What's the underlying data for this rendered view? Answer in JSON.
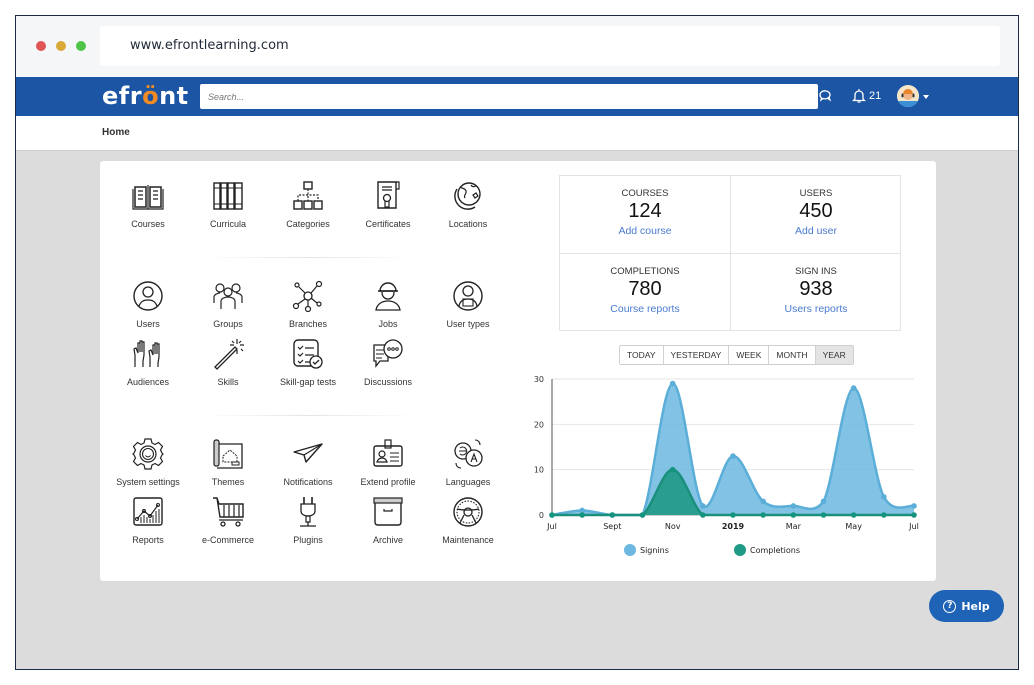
{
  "browser": {
    "url": "www.efrontlearning.com"
  },
  "navbar": {
    "logo": "efront",
    "search_placeholder": "Search...",
    "notifications_count": "21"
  },
  "breadcrumb": "Home",
  "tiles": {
    "admin": [
      {
        "label": "Courses",
        "icon": "book-icon"
      },
      {
        "label": "Curricula",
        "icon": "bookshelf-icon"
      },
      {
        "label": "Categories",
        "icon": "hierarchy-icon"
      },
      {
        "label": "Certificates",
        "icon": "certificate-icon"
      },
      {
        "label": "Locations",
        "icon": "globe-icon"
      }
    ],
    "people": [
      {
        "label": "Users",
        "icon": "user-icon"
      },
      {
        "label": "Groups",
        "icon": "group-icon"
      },
      {
        "label": "Branches",
        "icon": "branches-icon"
      },
      {
        "label": "Jobs",
        "icon": "worker-icon"
      },
      {
        "label": "User types",
        "icon": "user-type-icon"
      },
      {
        "label": "Audiences",
        "icon": "raised-hands-icon"
      },
      {
        "label": "Skills",
        "icon": "magic-wand-icon"
      },
      {
        "label": "Skill-gap tests",
        "icon": "checklist-icon"
      },
      {
        "label": "Discussions",
        "icon": "discussion-icon"
      }
    ],
    "system": [
      {
        "label": "System settings",
        "icon": "gear-icon"
      },
      {
        "label": "Themes",
        "icon": "blueprint-icon"
      },
      {
        "label": "Notifications",
        "icon": "paper-plane-icon"
      },
      {
        "label": "Extend profile",
        "icon": "id-card-icon"
      },
      {
        "label": "Languages",
        "icon": "translate-icon"
      },
      {
        "label": "Reports",
        "icon": "chart-icon"
      },
      {
        "label": "e-Commerce",
        "icon": "cart-icon"
      },
      {
        "label": "Plugins",
        "icon": "plug-icon"
      },
      {
        "label": "Archive",
        "icon": "archive-box-icon"
      },
      {
        "label": "Maintenance",
        "icon": "steering-wheel-icon"
      }
    ]
  },
  "stats": [
    {
      "title": "COURSES",
      "value": "124",
      "link": "Add course"
    },
    {
      "title": "USERS",
      "value": "450",
      "link": "Add user"
    },
    {
      "title": "COMPLETIONS",
      "value": "780",
      "link": "Course reports"
    },
    {
      "title": "SIGN INS",
      "value": "938",
      "link": "Users reports"
    }
  ],
  "periods": {
    "options": [
      "TODAY",
      "YESTERDAY",
      "WEEK",
      "MONTH",
      "YEAR"
    ],
    "selected": "YEAR"
  },
  "chart_data": {
    "type": "area",
    "x": [
      "Jul",
      "Aug",
      "Sept",
      "Oct",
      "Nov",
      "Dec",
      "2019",
      "Feb",
      "Mar",
      "Apr",
      "May",
      "Jun",
      "Jul"
    ],
    "tick_labels": [
      "Jul",
      "Sept",
      "Nov",
      "2019",
      "Mar",
      "May",
      "Jul"
    ],
    "ylim": [
      0,
      30
    ],
    "yticks": [
      0,
      10,
      20,
      30
    ],
    "grid": true,
    "legend": "bottom",
    "series": [
      {
        "name": "Signins",
        "color": "#6cb8e0",
        "values": [
          0,
          1,
          0,
          0,
          29,
          2,
          13,
          3,
          2,
          3,
          28,
          4,
          2
        ]
      },
      {
        "name": "Completions",
        "color": "#1f9a86",
        "values": [
          0,
          0,
          0,
          0,
          10,
          0,
          0,
          0,
          0,
          0,
          0,
          0,
          0
        ]
      }
    ]
  },
  "help": {
    "label": "Help"
  },
  "colors": {
    "brand": "#1c55a3",
    "accent": "#f08a24",
    "link": "#4a7bd0"
  }
}
